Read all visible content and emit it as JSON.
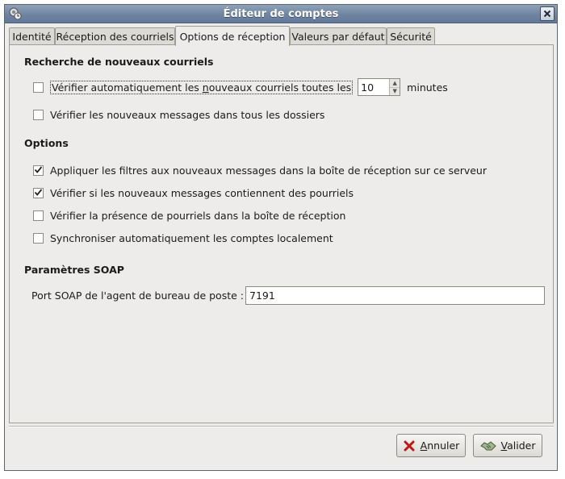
{
  "window": {
    "title": "Éditeur de comptes"
  },
  "tabs": [
    {
      "label": "Identité",
      "active": false
    },
    {
      "label": "Réception des courriels",
      "active": false
    },
    {
      "label": "Options de réception",
      "active": true
    },
    {
      "label": "Valeurs par défaut",
      "active": false
    },
    {
      "label": "Sécurité",
      "active": false
    }
  ],
  "check_new": {
    "heading": "Recherche de nouveaux courriels",
    "auto_check": {
      "label_before": "Vérifier automatiquement les ",
      "mnemonic": "n",
      "label_after": "ouveaux courriels toutes les",
      "checked": false,
      "interval_value": "10",
      "unit": "minutes"
    },
    "all_folders": {
      "label": "Vérifier les nouveaux messages dans tous les dossiers",
      "checked": false
    }
  },
  "options": {
    "heading": "Options",
    "items": [
      {
        "label": "Appliquer les filtres aux nouveaux messages dans la boîte de réception sur ce serveur",
        "checked": true
      },
      {
        "label": "Vérifier si les nouveaux messages contiennent des pourriels",
        "checked": true
      },
      {
        "label": "Vérifier la présence de pourriels dans la boîte de réception",
        "checked": false
      },
      {
        "label": "Synchroniser automatiquement les comptes localement",
        "checked": false
      }
    ]
  },
  "soap": {
    "heading": "Paramètres SOAP",
    "port_label": "Port SOAP de l'agent de bureau de poste :",
    "port_value": "7191"
  },
  "buttons": {
    "cancel": {
      "mnemonic": "A",
      "rest": "nnuler"
    },
    "ok": {
      "mnemonic": "V",
      "rest": "alider"
    }
  },
  "colors": {
    "titlebar": "#6e84a0",
    "window_bg": "#edeceb"
  }
}
